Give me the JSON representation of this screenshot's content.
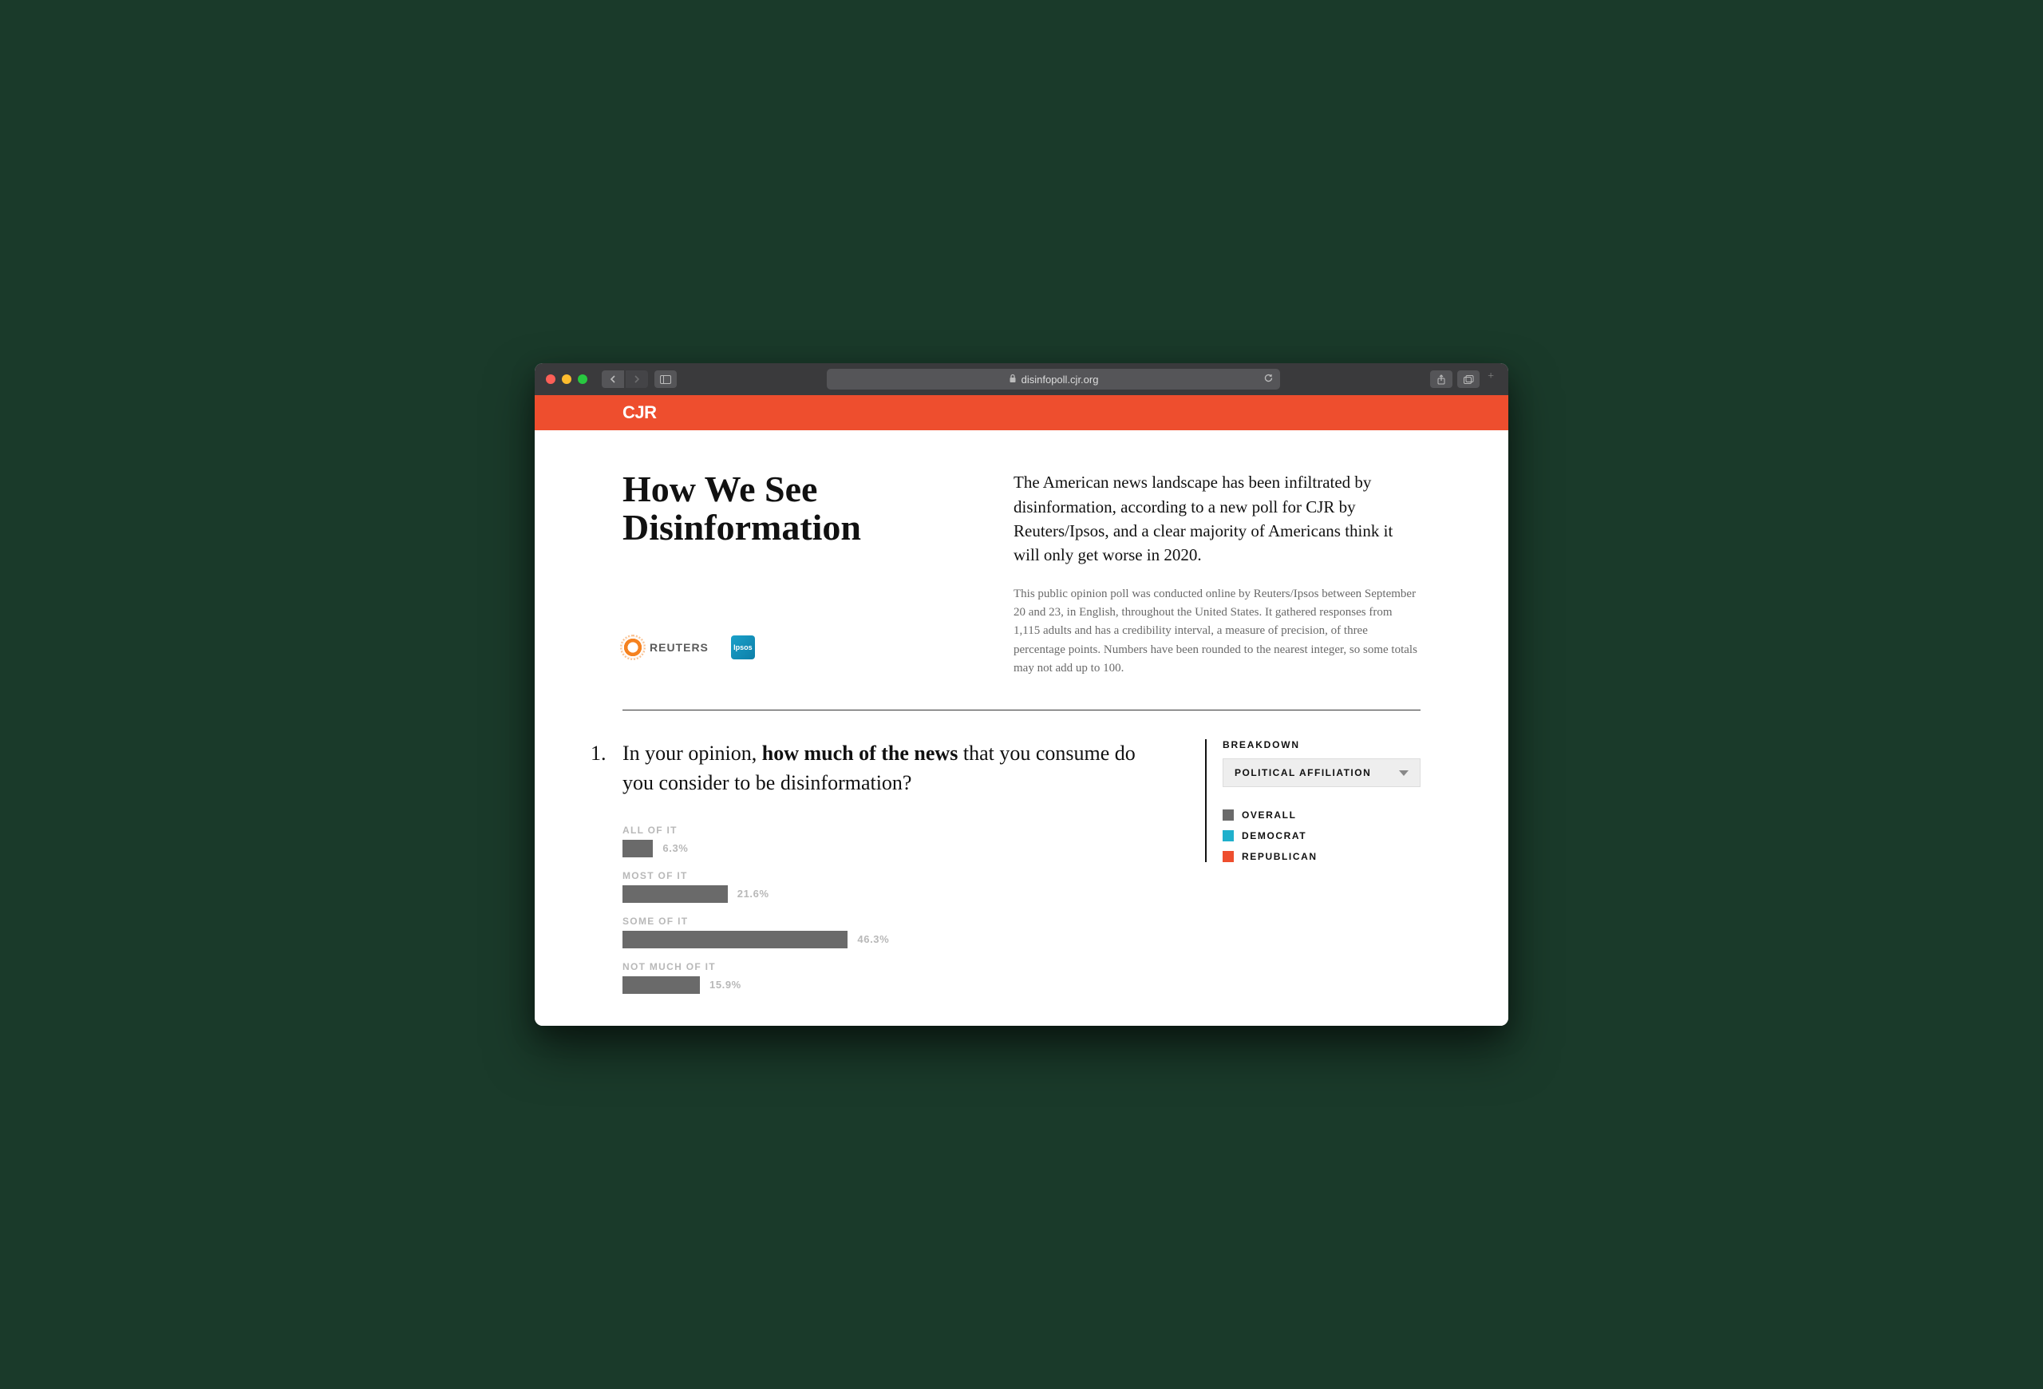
{
  "browser": {
    "url": "disinfopoll.cjr.org"
  },
  "header": {
    "site_logo": "CJR"
  },
  "hero": {
    "title": "How We See Disinformation",
    "sponsor_reuters": "REUTERS",
    "sponsor_ipsos": "Ipsos",
    "lede": "The American news landscape has been infiltrated by disinformation, according to a new poll for CJR by Reuters/Ipsos, and a clear majority of Americans think it will only get worse in 2020.",
    "methodology": "This public opinion poll was conducted online by Reuters/Ipsos between September 20 and 23, in English, throughout the United States. It gathered responses from 1,115 adults and has a credibility interval, a measure of precision, of three percentage points. Numbers have been rounded to the nearest integer, so some totals may not add up to 100."
  },
  "question": {
    "number": "1.",
    "pre": "In your opinion, ",
    "bold": "how much of the news",
    "post": " that you consume do you consider to be disinformation?"
  },
  "breakdown": {
    "heading": "BREAKDOWN",
    "selected": "POLITICAL AFFILIATION",
    "legend": [
      {
        "label": "OVERALL",
        "color": "#6a6a6a"
      },
      {
        "label": "DEMOCRAT",
        "color": "#1fb0cc"
      },
      {
        "label": "REPUBLICAN",
        "color": "#ee4e2e"
      }
    ]
  },
  "chart_data": {
    "type": "bar",
    "orientation": "horizontal",
    "categories": [
      "ALL OF IT",
      "MOST OF IT",
      "SOME OF IT",
      "NOT MUCH OF IT"
    ],
    "values": [
      6.3,
      21.6,
      46.3,
      15.9
    ],
    "value_labels": [
      "6.3%",
      "21.6%",
      "46.3%",
      "15.9%"
    ],
    "xmax": 100,
    "series_shown": "OVERALL"
  }
}
